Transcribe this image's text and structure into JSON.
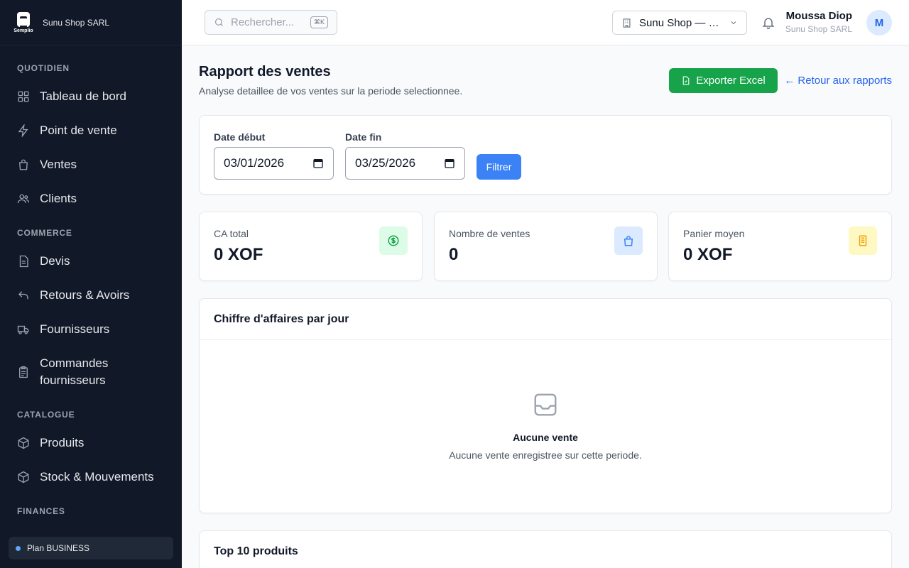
{
  "brand": {
    "logo_text": "Semplio",
    "company": "Sunu Shop SARL"
  },
  "sidebar": {
    "sections": [
      {
        "title": "QUOTIDIEN",
        "items": [
          {
            "label": "Tableau de bord",
            "icon": "dashboard-icon"
          },
          {
            "label": "Point de vente",
            "icon": "lightning-icon"
          },
          {
            "label": "Ventes",
            "icon": "shopping-bag-icon"
          },
          {
            "label": "Clients",
            "icon": "users-icon"
          }
        ]
      },
      {
        "title": "COMMERCE",
        "items": [
          {
            "label": "Devis",
            "icon": "document-icon"
          },
          {
            "label": "Retours & Avoirs",
            "icon": "return-icon"
          },
          {
            "label": "Fournisseurs",
            "icon": "truck-icon"
          },
          {
            "label": "Commandes fournisseurs",
            "icon": "clipboard-icon"
          }
        ]
      },
      {
        "title": "CATALOGUE",
        "items": [
          {
            "label": "Produits",
            "icon": "box-icon"
          },
          {
            "label": "Stock & Mouvements",
            "icon": "box-icon"
          }
        ]
      },
      {
        "title": "FINANCES",
        "items": []
      }
    ],
    "plan": "Plan BUSINESS"
  },
  "topbar": {
    "search_placeholder": "Rechercher...",
    "search_shortcut": "⌘K",
    "store": "Sunu Shop — Siège",
    "user_name": "Moussa Diop",
    "user_org": "Sunu Shop SARL",
    "avatar_letter": "M"
  },
  "page": {
    "title": "Rapport des ventes",
    "subtitle": "Analyse detaillee de vos ventes sur la periode selectionnee.",
    "export_label": "Exporter Excel",
    "back_label": "← Retour aux rapports"
  },
  "filters": {
    "start_label": "Date début",
    "start_value": "03/01/2026",
    "end_label": "Date fin",
    "end_value": "03/25/2026",
    "button": "Filtrer"
  },
  "stats": [
    {
      "label": "CA total",
      "value": "0 XOF",
      "color": "#16a34a",
      "bg": "#dcfce7",
      "icon": "dollar-icon"
    },
    {
      "label": "Nombre de ventes",
      "value": "0",
      "color": "#3b82f6",
      "bg": "#dbeafe",
      "icon": "bag-icon"
    },
    {
      "label": "Panier moyen",
      "value": "0 XOF",
      "color": "#f59e0b",
      "bg": "#fef9c3",
      "icon": "receipt-icon"
    }
  ],
  "chart_card": {
    "title": "Chiffre d'affaires par jour",
    "empty_title": "Aucune vente",
    "empty_text": "Aucune vente enregistree sur cette periode."
  },
  "top_card": {
    "title": "Top 10 produits"
  }
}
